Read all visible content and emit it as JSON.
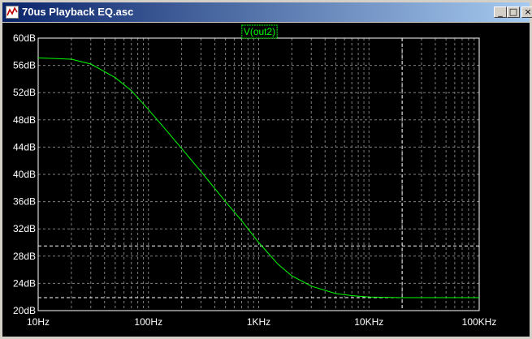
{
  "window": {
    "title": "70us Playback EQ.asc",
    "minimize_glyph": "_",
    "maximize_glyph": "□",
    "close_glyph": "×",
    "app_icon": "waveform-icon"
  },
  "colors": {
    "background": "#000000",
    "trace": "#00ff00",
    "grid": "#7f7f7f",
    "text": "#ffffff",
    "cursor": "#ffffff"
  },
  "chart_data": {
    "type": "line",
    "series": [
      {
        "name": "V(out2)",
        "x": [
          10,
          20,
          30,
          50,
          70,
          100,
          150,
          200,
          300,
          500,
          700,
          1000,
          1500,
          2000,
          3000,
          5000,
          7000,
          10000,
          20000,
          100000
        ],
        "y": [
          57.1,
          56.9,
          56.2,
          54.2,
          52.3,
          49.5,
          46.2,
          43.8,
          40.4,
          36.0,
          33.2,
          30.0,
          26.8,
          25.1,
          23.6,
          22.5,
          22.2,
          22.0,
          21.9,
          21.9
        ]
      }
    ],
    "xscale": "log",
    "xlim": [
      10,
      100000
    ],
    "ylim": [
      20,
      60
    ],
    "xticks": [
      10,
      100,
      1000,
      10000,
      100000
    ],
    "xticklabels": [
      "10Hz",
      "100Hz",
      "1KHz",
      "10KHz",
      "100KHz"
    ],
    "yticks": [
      20,
      24,
      28,
      32,
      36,
      40,
      44,
      48,
      52,
      56,
      60
    ],
    "yticklabels": [
      "20dB",
      "24dB",
      "28dB",
      "32dB",
      "36dB",
      "40dB",
      "44dB",
      "48dB",
      "52dB",
      "56dB",
      "60dB"
    ],
    "grid": true,
    "cursors": {
      "x": [
        20000
      ],
      "y": [
        29.5,
        21.9
      ]
    }
  }
}
